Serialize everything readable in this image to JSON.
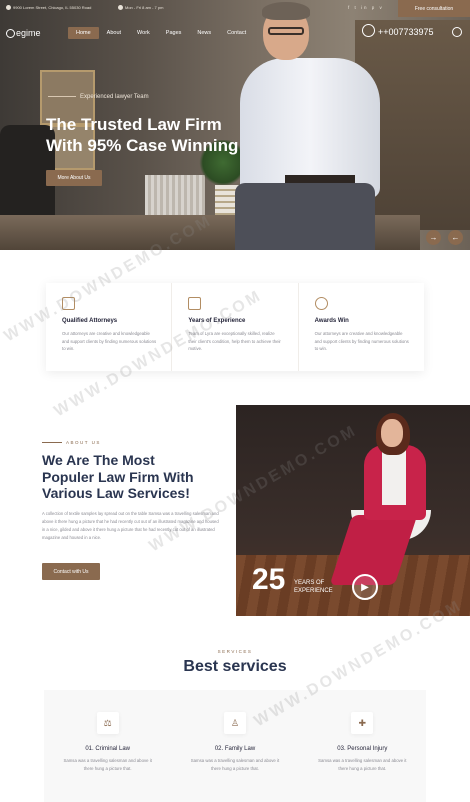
{
  "topbar": {
    "address": "9900 Lorem Street, Chicago, IL 55030 Road",
    "hours": "Mon - Fri 8 am - 7 pm",
    "social": "f t in p v",
    "consult_label": "Free consultation"
  },
  "header": {
    "logo": "egime",
    "nav": [
      "Home",
      "About",
      "Work",
      "Pages",
      "News",
      "Contact"
    ],
    "phone": "++007733975"
  },
  "hero": {
    "subtitle": "Experienced lawyer Team",
    "title_line1": "The Trusted Law Firm",
    "title_line2": "With 95% Case Winning",
    "button": "More About Us",
    "next_arrow": "→",
    "prev_arrow": "←"
  },
  "features": [
    {
      "title": "Qualified Attorneys",
      "text": "Our attorneys are creative and knowledgeable and support clients by finding numerous solutions to win."
    },
    {
      "title": "Years of Experience",
      "text": "Team of Lyra are exceptionally skilled, realize their client's condition, help them to achieve their motive."
    },
    {
      "title": "Awards Win",
      "text": "Our attorneys are creative and knowledgeable and support clients by finding numerous solutions to win."
    }
  ],
  "about": {
    "label": "ABOUT US",
    "title_line1": "We Are The Most",
    "title_line2": "Populer Law Firm With",
    "title_line3": "Various Law Services!",
    "text": "A collection of textile samples lay spread out on the table Samsa was a travelling salesman and above it there hung a picture that he had recently cut out of an illustrated magazine and housed in a nice, gilded and above it there hung a picture that he had recently cut out of an illustrated magazine and housed in a nice.",
    "button": "Contact with Us",
    "years_number": "25",
    "years_line1": "YEARS OF",
    "years_line2": "EXPERIENCE",
    "play_symbol": "▶"
  },
  "services": {
    "label": "SERVICES",
    "title": "Best services",
    "items": [
      {
        "name": "01. Criminal Law",
        "text": "Samsa was a travelling salesman and above it there hung a picture that."
      },
      {
        "name": "02. Family Law",
        "text": "Samsa was a travelling salesman and above it there hung a picture that."
      },
      {
        "name": "03. Personal Injury",
        "text": "Samsa was a travelling salesman and above it there hung a picture that."
      }
    ]
  },
  "watermark": "WWW.DOWNDEMO.COM",
  "colors": {
    "accent": "#8a6a4f",
    "heading": "#2a3550"
  }
}
